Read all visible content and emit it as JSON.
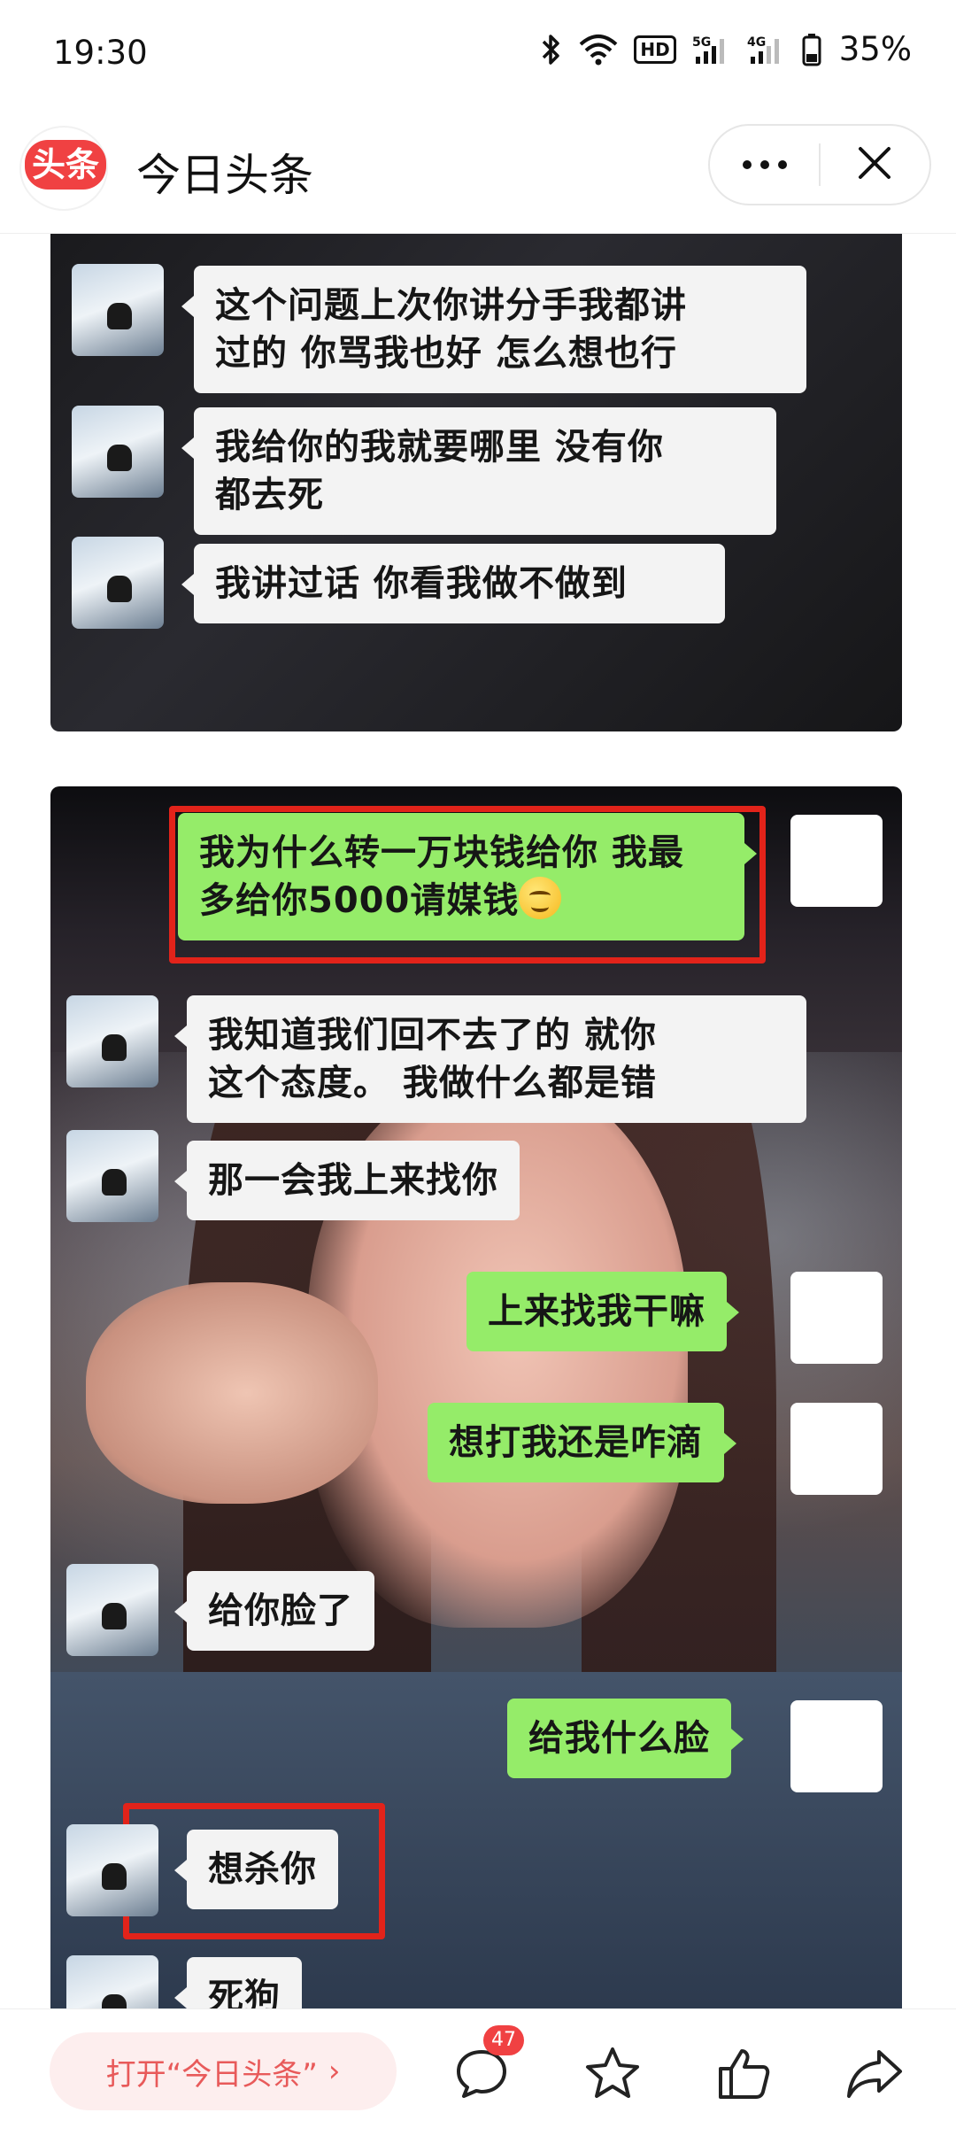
{
  "status_bar": {
    "time": "19:30",
    "battery": "35%",
    "hd_label": "HD",
    "net_5g": "5G",
    "net_4g": "4G"
  },
  "header": {
    "logo_text": "头条",
    "title": "今日头条",
    "more_icon": "more-icon",
    "close_icon": "close-icon"
  },
  "image1": {
    "messages": [
      {
        "side": "in",
        "text_line1": "这个问题上次你讲分手我都讲",
        "text_line2": "过的   你骂我也好   怎么想也行"
      },
      {
        "side": "in",
        "text_line1": "我给你的我就要哪里    没有你",
        "text_line2": "都去死"
      },
      {
        "side": "in",
        "text_line1": "我讲过话   你看我做不做到",
        "text_line2": ""
      }
    ]
  },
  "image2": {
    "messages": [
      {
        "side": "out",
        "text_line1": "我为什么转一万块钱给你 我最",
        "text_line2": "多给你5000请媒钱",
        "emoji": "smile-emoji"
      },
      {
        "side": "in",
        "text_line1": "我知道我们回不去了的   就你",
        "text_line2": "这个态度。  我做什么都是错"
      },
      {
        "side": "in",
        "text": "那一会我上来找你"
      },
      {
        "side": "out",
        "text": "上来找我干嘛"
      },
      {
        "side": "out",
        "text": "想打我还是咋滴"
      },
      {
        "side": "in",
        "text": "给你脸了"
      },
      {
        "side": "out",
        "text": "给我什么脸"
      },
      {
        "side": "in",
        "text": "想杀你"
      },
      {
        "side": "in",
        "text": "死狗"
      }
    ]
  },
  "bottom_bar": {
    "open_app_label": "打开“今日头条”",
    "open_app_arrow": "›",
    "comment_count": "47",
    "comment_icon": "comment-icon",
    "favorite_icon": "star-icon",
    "like_icon": "thumbs-up-icon",
    "share_icon": "share-icon"
  },
  "colors": {
    "brand_red": "#f04142",
    "wechat_green": "#95ec69",
    "highlight_red": "#e2231a"
  }
}
